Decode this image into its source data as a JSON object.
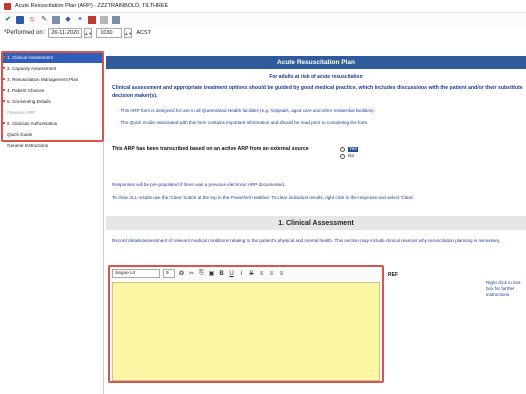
{
  "window": {
    "title": "Acute Resuscitation Plan (ARP) - ZZZTRAINBOLD, TILTHREE"
  },
  "toolbar": {
    "icons": [
      "check-icon",
      "save-icon",
      "stop-icon",
      "nav-icon",
      "chart-icon",
      "diamond-icon",
      "plus-icon",
      "grid-icon",
      "red-icon",
      "gray-icon"
    ]
  },
  "performed": {
    "label": "*Performed on:",
    "date": "26-11-2020",
    "time": "1030",
    "tz": "ACST"
  },
  "sidebar": {
    "items": [
      {
        "label": "1. Clinical Assessment",
        "selected": true
      },
      {
        "label": "2. Capacity Assessment",
        "selected": false
      },
      {
        "label": "3. Resuscitation Management Plan",
        "selected": false
      },
      {
        "label": "4. Patient Choices",
        "selected": false
      },
      {
        "label": "5. Consenting Details",
        "selected": false
      },
      {
        "label": "Previous ARP",
        "selected": false,
        "disabled": true
      },
      {
        "label": "6. Clinician Authorisation",
        "selected": false
      },
      {
        "label": "Quick Guide",
        "selected": false
      },
      {
        "label": "General Instructions",
        "selected": false
      }
    ]
  },
  "main": {
    "header": "Acute Resuscitation Plan",
    "subtitle": "For adults at risk of acute resuscitation",
    "intro": "Clinical assessment and appropriate treatment options should be guided by good medical practice, which includes discussions with the patient and/or their substitute decision maker(s).",
    "bullets": [
      ". This ARP form is designed for use in all Queensland Health facilities (e.g. hospitals, aged care and other residential facilities).",
      ". The Quick Guide associated with this form contains important information and should be read prior to completing the form."
    ],
    "transcribed_question": "This ARP has been transcribed based on an active ARP from an external source",
    "radio_yes": "Yes",
    "radio_no": "No",
    "note1": "Responses will be pre-populated if there was a previous electronic ARP documented.",
    "note2": "To clear ALL results use the 'Clear' button at the top in the Powerform taskbar. To clear individual results, right click in the response and select 'Clear'.",
    "section_title": "1. Clinical Assessment",
    "record_text": "Record details/assessment of relevant medical conditions relating to the patient's physical and mental health. This section may include clinical reasons why resuscitation planning is necessary.",
    "editor": {
      "font": "Segoe UI",
      "size": "9",
      "icons": [
        "spell-icon",
        "cut-icon",
        "copy-icon",
        "paste-icon",
        "bold-icon",
        "underline-icon",
        "italic-icon",
        "strike-icon",
        "align-left-icon",
        "align-center-icon",
        "align-right-icon"
      ],
      "bold": "B",
      "underline": "U",
      "italic": "I",
      "strike": "S"
    },
    "ref_label": "REF",
    "right_help": "Right click in text box for further instructions"
  }
}
